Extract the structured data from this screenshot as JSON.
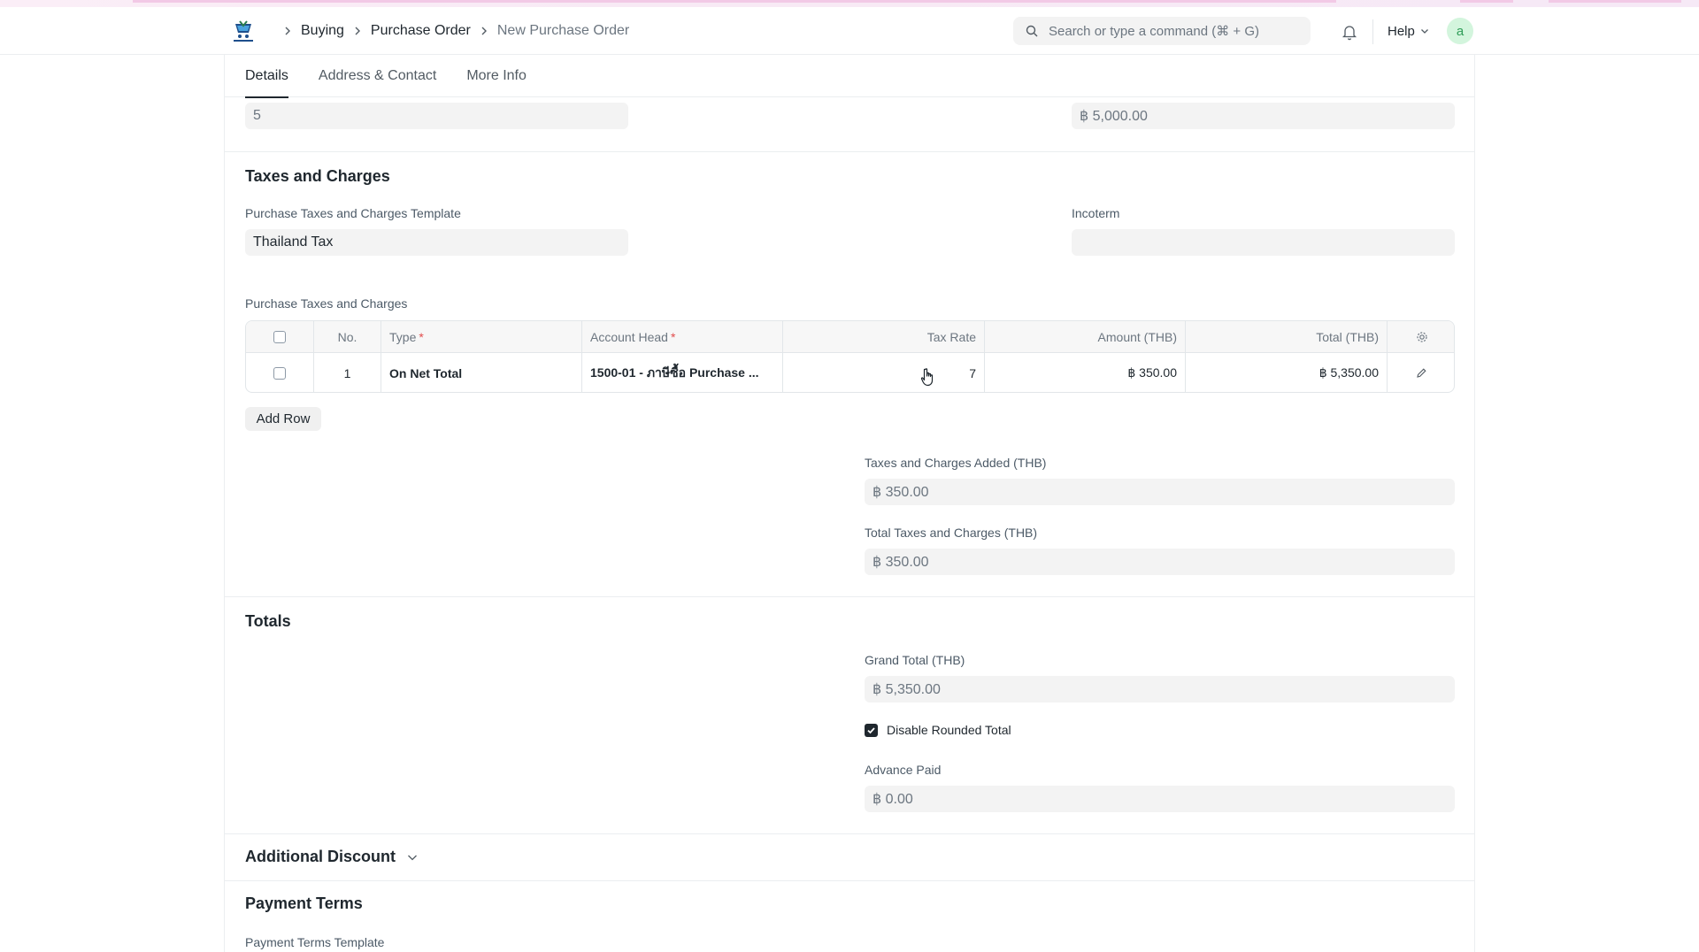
{
  "navbar": {
    "breadcrumbs": [
      "Buying",
      "Purchase Order",
      "New Purchase Order"
    ],
    "search_placeholder": "Search or type a command (⌘ + G)",
    "help_label": "Help",
    "avatar_initial": "a"
  },
  "tabs": [
    {
      "label": "Details",
      "active": true
    },
    {
      "label": "Address & Contact",
      "active": false
    },
    {
      "label": "More Info",
      "active": false
    }
  ],
  "top_fields": {
    "left_value": "5",
    "right_value": "฿ 5,000.00"
  },
  "taxes_section": {
    "title": "Taxes and Charges",
    "template_label": "Purchase Taxes and Charges Template",
    "template_value": "Thailand Tax",
    "incoterm_label": "Incoterm",
    "incoterm_value": "",
    "table_label": "Purchase Taxes and Charges",
    "table_headers": {
      "no": "No.",
      "type": "Type",
      "account_head": "Account Head",
      "tax_rate": "Tax Rate",
      "amount": "Amount (THB)",
      "total": "Total (THB)"
    },
    "rows": [
      {
        "no": "1",
        "type": "On Net Total",
        "account_head": "1500-01 - ภาษีซื้อ Purchase ...",
        "tax_rate": "7",
        "amount": "฿ 350.00",
        "total": "฿ 5,350.00"
      }
    ],
    "add_row_label": "Add Row",
    "added_label": "Taxes and Charges Added (THB)",
    "added_value": "฿ 350.00",
    "total_label": "Total Taxes and Charges (THB)",
    "total_value": "฿ 350.00"
  },
  "totals_section": {
    "title": "Totals",
    "grand_total_label": "Grand Total (THB)",
    "grand_total_value": "฿ 5,350.00",
    "disable_rounded_label": "Disable Rounded Total",
    "disable_rounded_checked": true,
    "advance_paid_label": "Advance Paid",
    "advance_paid_value": "฿ 0.00"
  },
  "additional_discount": {
    "title": "Additional Discount"
  },
  "payment_terms": {
    "title": "Payment Terms",
    "template_label": "Payment Terms Template"
  },
  "colors": {
    "accent": "#1f272e",
    "field_bg": "#f3f3f3",
    "avatar_bg": "#d3f5dd",
    "avatar_fg": "#2f9d58",
    "required": "#e24c4c"
  }
}
